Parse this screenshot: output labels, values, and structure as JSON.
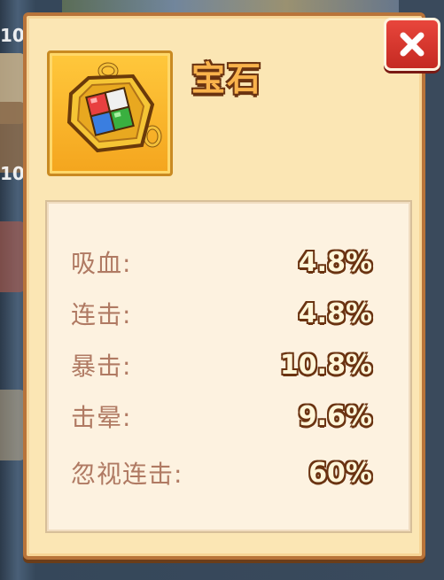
{
  "background": {
    "numbers": [
      "10",
      "10"
    ]
  },
  "dialog": {
    "title": "宝石",
    "item_icon": "gem-amulet-icon",
    "close_icon": "close-icon"
  },
  "stats": [
    {
      "label": "吸血:",
      "value": "4.8%"
    },
    {
      "label": "连击:",
      "value": "4.8%"
    },
    {
      "label": "暴击:",
      "value": "10.8%"
    },
    {
      "label": "击晕:",
      "value": "9.6%"
    },
    {
      "label": "忽视连击:",
      "value": "60%"
    }
  ],
  "colors": {
    "panel": "#fbe6b4",
    "panel_border": "#b8743a",
    "title_fill": "#f9b34c",
    "outline": "#6a3311",
    "label": "#b07a63",
    "close_button": "#d8382e"
  }
}
